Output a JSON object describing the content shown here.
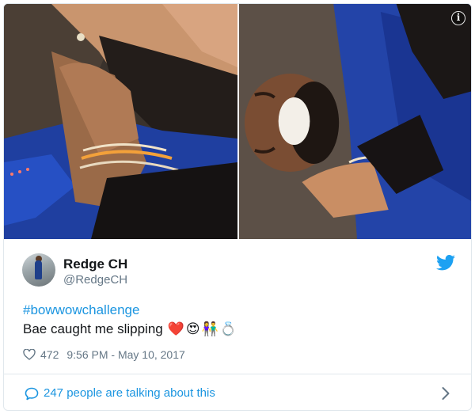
{
  "user": {
    "name": "Redge CH",
    "handle": "@RedgeCH"
  },
  "tweet": {
    "hashtag": "#bowwowchallenge",
    "text": "Bae caught me slipping",
    "emojis": [
      "❤️",
      "😍",
      "👫",
      "💍"
    ],
    "likes": "472",
    "timestamp": "9:56 PM - May 10, 2017"
  },
  "footer": {
    "talking": "247 people are talking about this"
  },
  "icons": {
    "info": "info-icon",
    "twitter": "twitter-bird-icon",
    "like": "heart-icon",
    "conversation": "speech-bubble-icon",
    "expand": "chevron-right-icon"
  },
  "colors": {
    "link": "#1b95e0",
    "secondary_text": "#657786",
    "border": "#e1e8ed",
    "text": "#14171a"
  }
}
